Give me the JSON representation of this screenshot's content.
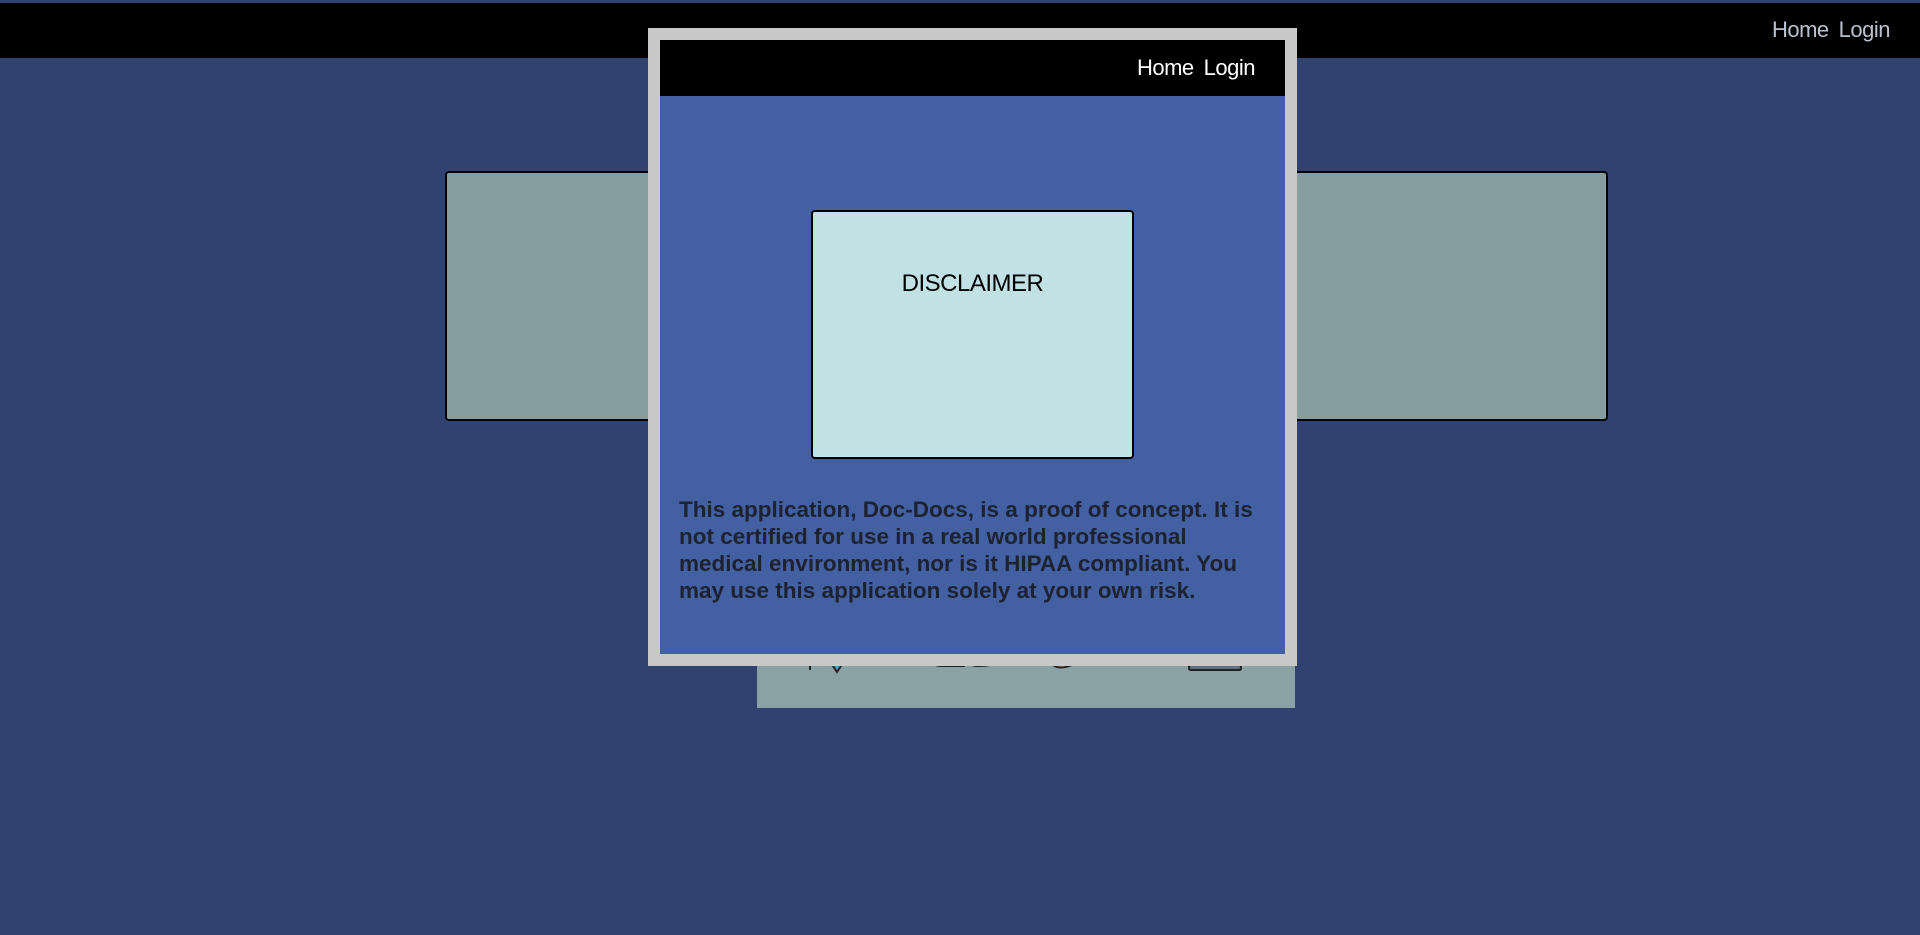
{
  "background_nav": {
    "home_label": "Home",
    "login_label": "Login"
  },
  "modal": {
    "nav": {
      "home_label": "Home",
      "login_label": "Login"
    },
    "title": "DISCLAIMER",
    "body": "This application, Doc-Docs, is a proof of concept. It is not certified for use in a real world professional medical environment, nor is it HIPAA compliant. You may use this application solely at your own risk."
  },
  "icons": [
    "stethoscope-icon",
    "pill-bottles-icon",
    "bandage-icon",
    "clipboard-icon"
  ],
  "colors": {
    "page_background": "#2f4270",
    "topbar": "#000000",
    "modal_frame": "#c8c8c8",
    "modal_background": "#4360a3",
    "disclaimer_box": "#c1e1e4",
    "hero_box": "#869ea0"
  }
}
